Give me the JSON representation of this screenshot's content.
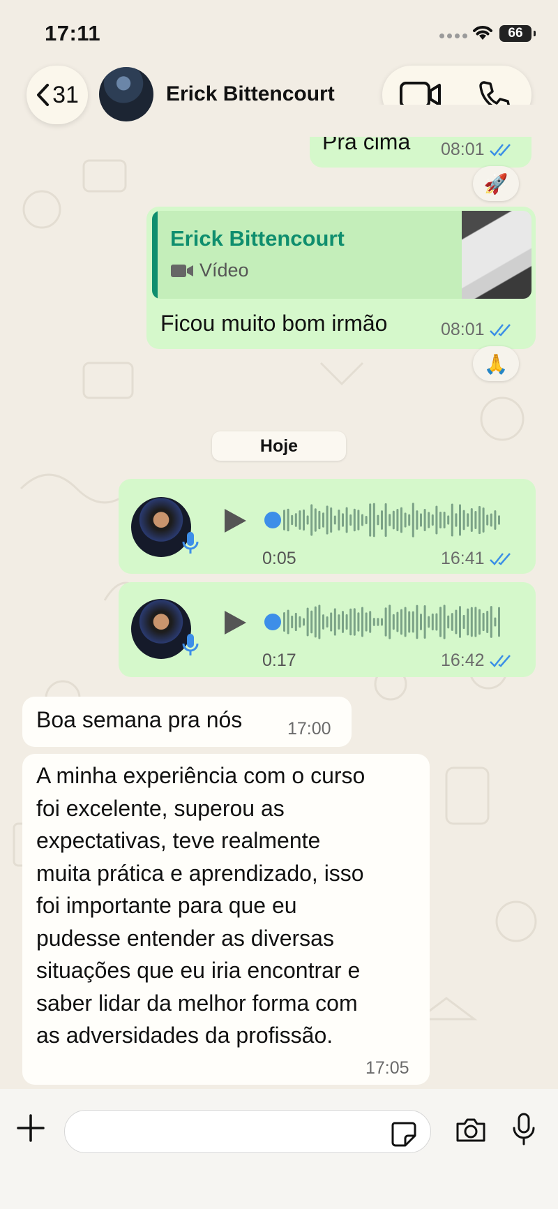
{
  "status_bar": {
    "time": "17:11",
    "battery": "66"
  },
  "header": {
    "back_count": "31",
    "contact_name": "Erick Bittencourt"
  },
  "messages": {
    "m1": {
      "text": "Pra cima",
      "time": "08:01",
      "reaction": "🚀"
    },
    "m2": {
      "reply_name": "Erick Bittencourt",
      "reply_type": "Vídeo",
      "text": "Ficou muito bom irmão",
      "time": "08:01",
      "reaction": "🙏"
    },
    "date_separator": "Hoje",
    "voice1": {
      "duration": "0:05",
      "time": "16:41"
    },
    "voice2": {
      "duration": "0:17",
      "time": "16:42"
    },
    "in1": {
      "text": "Boa semana pra nós",
      "time": "17:00"
    },
    "in2": {
      "lines": [
        "A minha experiência com o curso",
        "foi excelente, superou as",
        "expectativas, teve realmente",
        "muita prática e aprendizado, isso",
        "foi importante para que eu",
        "pudesse entender as diversas",
        "situações que eu iria encontrar e",
        "saber lidar da melhor forma com",
        "as adversidades da profissão."
      ],
      "time": "17:05"
    }
  },
  "colors": {
    "outgoing": "#d5f8cb",
    "incoming": "#fffefa",
    "read_ticks": "#3b8fe6",
    "reply_accent": "#0f8e6e",
    "voice_dot": "#3d8ee8"
  }
}
